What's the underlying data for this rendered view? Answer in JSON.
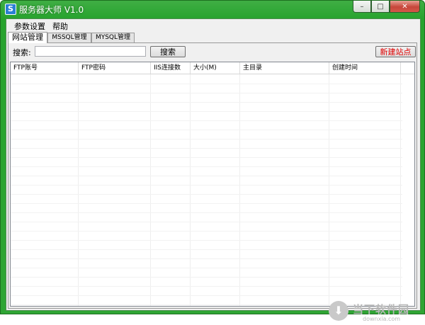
{
  "window": {
    "title": "服务器大师 V1.0",
    "app_icon_letter": "S"
  },
  "caption_buttons": {
    "minimize": "–",
    "maximize": "□",
    "close": "✕"
  },
  "menu": [
    {
      "label": "参数设置"
    },
    {
      "label": "帮助"
    }
  ],
  "tabs": [
    {
      "label": "网站管理",
      "active": true
    },
    {
      "label": "MSSQL管理",
      "active": false
    },
    {
      "label": "MYSQL管理",
      "active": false
    }
  ],
  "search": {
    "label": "搜索:",
    "value": "",
    "placeholder": "",
    "button": "搜索"
  },
  "new_site_button": {
    "label": "新建站点",
    "color": "#e00000"
  },
  "table": {
    "columns": [
      "FTP账号",
      "FTP密码",
      "IIS连接数",
      "大小(M)",
      "主目录",
      "创建时间"
    ],
    "rows": []
  },
  "watermark": {
    "text": "当下软件园",
    "sub": "downxia.com"
  },
  "colors": {
    "title_bar": "#2fa534",
    "new_button_text": "#e00000"
  }
}
